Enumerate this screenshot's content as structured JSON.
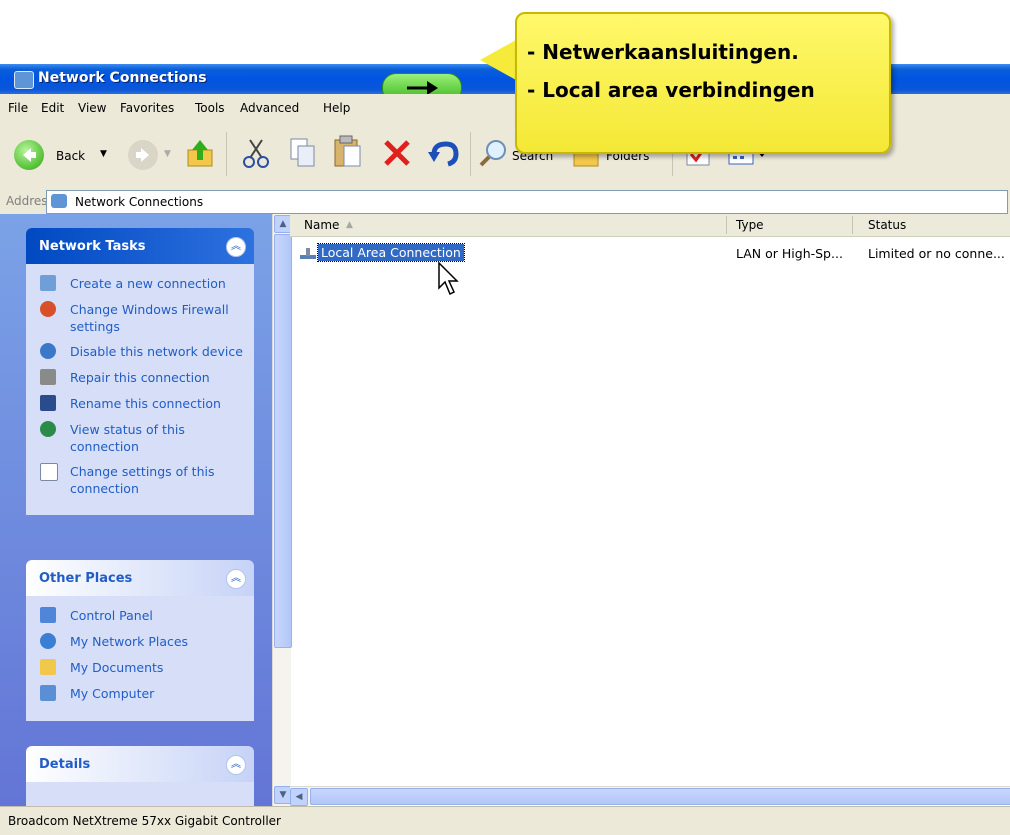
{
  "window": {
    "title": "Network Connections"
  },
  "menu": [
    "File",
    "Edit",
    "View",
    "Favorites",
    "Tools",
    "Advanced",
    "Help"
  ],
  "toolbar": {
    "back_label": "Back",
    "search_label": "Search",
    "folders_label": "Folders"
  },
  "address": {
    "label": "Address",
    "value": "Network Connections"
  },
  "network_tasks": {
    "title": "Network Tasks",
    "items": [
      "Create a new connection",
      "Change Windows Firewall settings",
      "Disable this network device",
      "Repair this connection",
      "Rename this connection",
      "View status of this connection",
      "Change settings of this connection"
    ]
  },
  "other_places": {
    "title": "Other Places",
    "items": [
      "Control Panel",
      "My Network Places",
      "My Documents",
      "My Computer"
    ]
  },
  "details": {
    "title": "Details"
  },
  "list": {
    "columns": [
      "Name",
      "Type",
      "Status"
    ],
    "rows": [
      {
        "name": "Local Area Connection",
        "type": "LAN or High-Sp...",
        "status": "Limited or no conne..."
      }
    ]
  },
  "statusbar": {
    "text": "Broadcom NetXtreme 57xx Gigabit Controller"
  },
  "callout": {
    "line1": "- Netwerkaansluitingen.",
    "line2": "- Local area verbindingen"
  },
  "colors": {
    "titlebar": "#0054e3",
    "callout": "#f4e836",
    "selection": "#316ac5"
  }
}
